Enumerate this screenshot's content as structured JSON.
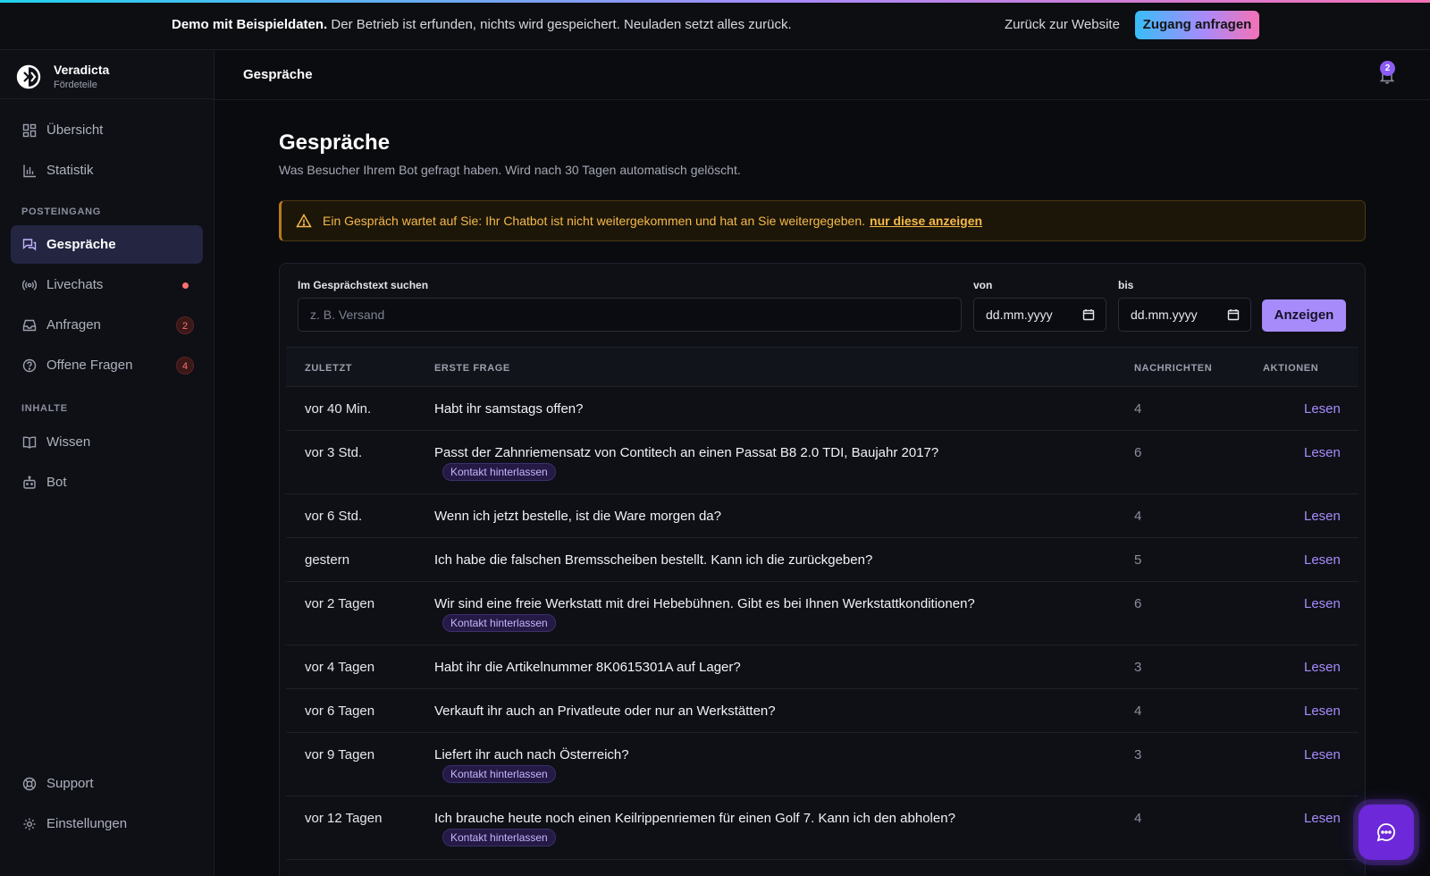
{
  "banner": {
    "bold": "Demo mit Beispieldaten.",
    "text": "Der Betrieb ist erfunden, nichts wird gespeichert. Neuladen setzt alles zurück.",
    "back_link": "Zurück zur Website",
    "access_button": "Zugang anfragen"
  },
  "brand": {
    "name": "Veradicta",
    "sub": "Fördeteile"
  },
  "sidebar": {
    "items": [
      {
        "label": "Übersicht",
        "icon": "grid-icon"
      },
      {
        "label": "Statistik",
        "icon": "bar-chart-icon"
      },
      {
        "label": "Gespräche",
        "icon": "chat-bubbles-icon"
      },
      {
        "label": "Livechats",
        "icon": "broadcast-icon"
      },
      {
        "label": "Anfragen",
        "icon": "inbox-icon",
        "badge": "2"
      },
      {
        "label": "Offene Fragen",
        "icon": "question-circle-icon",
        "badge": "4"
      },
      {
        "label": "Wissen",
        "icon": "book-icon"
      },
      {
        "label": "Bot",
        "icon": "robot-icon"
      },
      {
        "label": "Support",
        "icon": "lifebuoy-icon"
      },
      {
        "label": "Einstellungen",
        "icon": "gear-icon"
      }
    ],
    "section_inbox": "POSTEINGANG",
    "section_content": "INHALTE"
  },
  "header": {
    "title": "Gespräche",
    "notifications": "2"
  },
  "main": {
    "title": "Gespräche",
    "subtitle": "Was Besucher Ihrem Bot gefragt haben. Wird nach 30 Tagen automatisch gelöscht.",
    "alert_text": "Ein Gespräch wartet auf Sie: Ihr Chatbot ist nicht weitergekommen und hat an Sie weitergegeben.",
    "alert_link": "nur diese anzeigen"
  },
  "filters": {
    "search_label": "Im Gesprächstext suchen",
    "search_placeholder": "z. B. Versand",
    "from_label": "von",
    "to_label": "bis",
    "date_placeholder": "dd.mm.yyyy",
    "show_button": "Anzeigen"
  },
  "table": {
    "headers": {
      "time": "ZULETZT",
      "question": "ERSTE FRAGE",
      "messages": "NACHRICHTEN",
      "actions": "AKTIONEN"
    },
    "tag_label": "Kontakt hinterlassen",
    "action_label": "Lesen",
    "rows": [
      {
        "time": "vor 40 Min.",
        "question": "Habt ihr samstags offen?",
        "messages": "4"
      },
      {
        "time": "vor 3 Std.",
        "question": "Passt der Zahnriemensatz von Contitech an einen Passat B8 2.0 TDI, Baujahr 2017?",
        "messages": "6",
        "tag": "Kontakt hinterlassen"
      },
      {
        "time": "vor 6 Std.",
        "question": "Wenn ich jetzt bestelle, ist die Ware morgen da?",
        "messages": "4"
      },
      {
        "time": "gestern",
        "question": "Ich habe die falschen Bremsscheiben bestellt. Kann ich die zurückgeben?",
        "messages": "5"
      },
      {
        "time": "vor 2 Tagen",
        "question": "Wir sind eine freie Werkstatt mit drei Hebebühnen. Gibt es bei Ihnen Werkstattkonditionen?",
        "messages": "6",
        "tag": "Kontakt hinterlassen"
      },
      {
        "time": "vor 4 Tagen",
        "question": "Habt ihr die Artikelnummer 8K0615301A auf Lager?",
        "messages": "3"
      },
      {
        "time": "vor 6 Tagen",
        "question": "Verkauft ihr auch an Privatleute oder nur an Werkstätten?",
        "messages": "4"
      },
      {
        "time": "vor 9 Tagen",
        "question": "Liefert ihr auch nach Österreich?",
        "messages": "3",
        "tag": "Kontakt hinterlassen"
      },
      {
        "time": "vor 12 Tagen",
        "question": "Ich brauche heute noch einen Keilrippenriemen für einen Golf 7. Kann ich den abholen?",
        "messages": "4",
        "tag": "Kontakt hinterlassen"
      }
    ]
  },
  "colors": {
    "accent": "#a78bfa",
    "warning": "#f6b94a",
    "danger": "#f87171"
  }
}
